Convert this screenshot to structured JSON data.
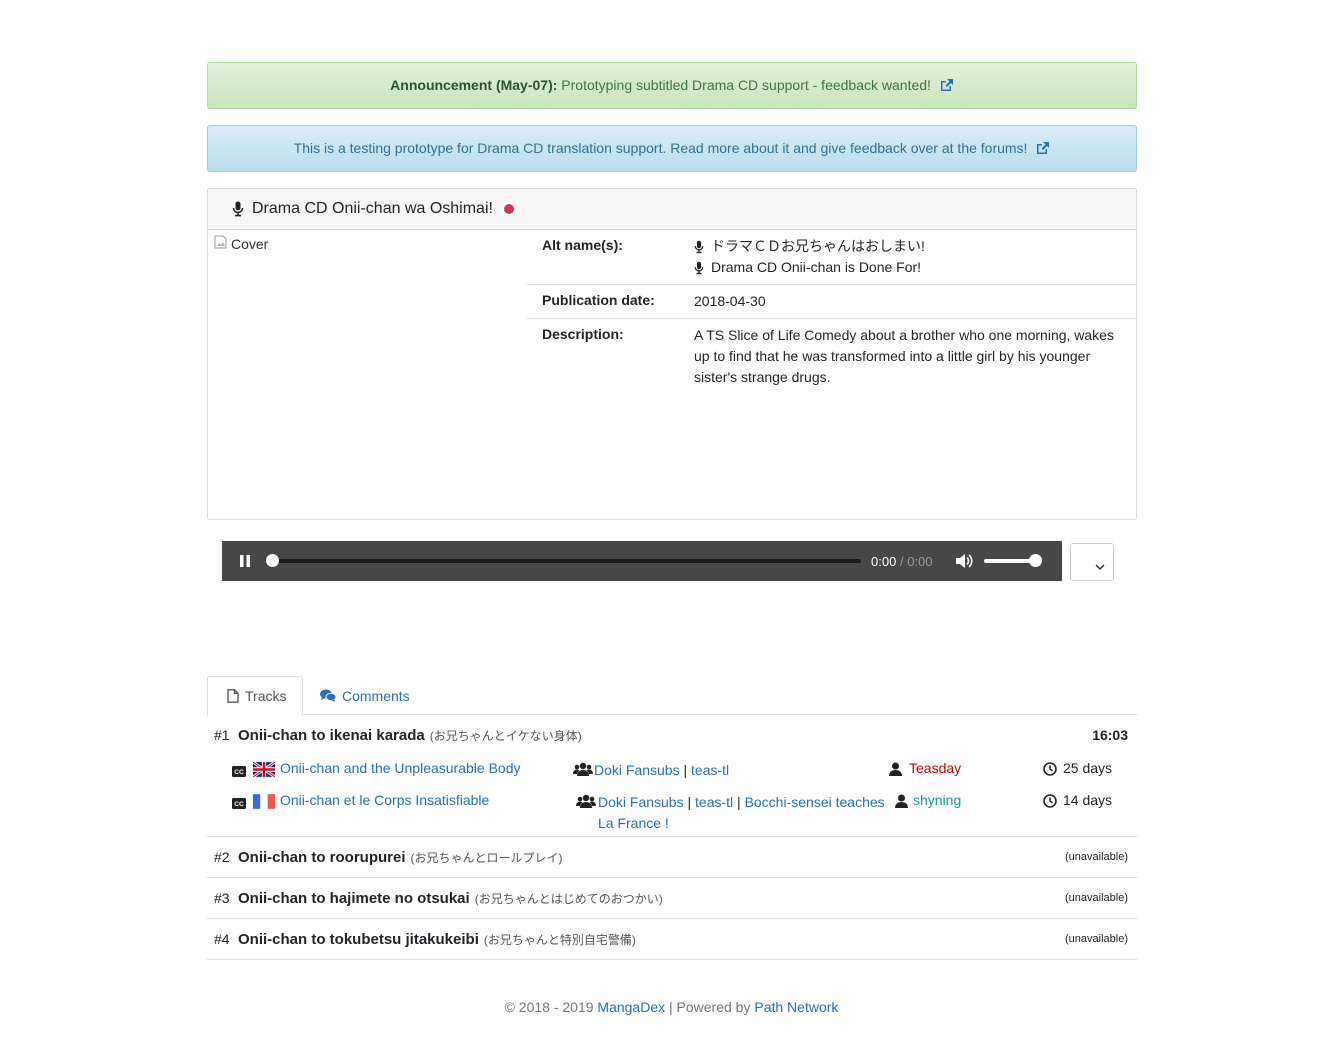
{
  "announcement": {
    "label": "Announcement (May-07):",
    "text": "Prototyping subtitled Drama CD support - feedback wanted!"
  },
  "info_banner": {
    "text": "This is a testing prototype for Drama CD translation support. Read more about it and give feedback over at the forums!"
  },
  "title": {
    "name": "Drama CD Onii-chan wa Oshimai!"
  },
  "cover": {
    "alt": "Cover"
  },
  "details": {
    "alt_label": "Alt name(s):",
    "alt_names": [
      "ドラマＣＤお兄ちゃんはおしまい!",
      "Drama CD Onii-chan is Done For!"
    ],
    "pub_label": "Publication date:",
    "pub_date": "2018-04-30",
    "desc_label": "Description:",
    "description": "A TS Slice of Life Comedy about a brother who one morning, wakes up to find that he was transformed into a little girl by his younger sister's strange drugs."
  },
  "player": {
    "current": "0:00",
    "separator": "/",
    "duration": "0:00",
    "progress": 0,
    "volume": 1.0
  },
  "tabs": {
    "tracks": "Tracks",
    "comments": "Comments"
  },
  "tracks": [
    {
      "num": "#1",
      "name": "Onii-chan to ikenai karada",
      "jp": "(お兄ちゃんとイケない身体)",
      "length": "16:03",
      "subs": [
        {
          "flag": "gb",
          "title": "Onii-chan and the Unpleasurable Body",
          "groups": [
            "Doki Fansubs",
            "teas-tl"
          ],
          "user": "Teasday",
          "age": "25 days"
        },
        {
          "flag": "fr",
          "title": "Onii-chan et le Corps Insatisfiable",
          "groups": [
            "Doki Fansubs",
            "teas-tl",
            "Bocchi-sensei teaches La France !"
          ],
          "user": "shyning",
          "age": "14 days"
        }
      ]
    },
    {
      "num": "#2",
      "name": "Onii-chan to roorupurei",
      "jp": "(お兄ちゃんとロールプレイ)",
      "status": "(unavailable)"
    },
    {
      "num": "#3",
      "name": "Onii-chan to hajimete no otsukai",
      "jp": "(お兄ちゃんとはじめてのおつかい)",
      "status": "(unavailable)"
    },
    {
      "num": "#4",
      "name": "Onii-chan to tokubetsu jitakukeibi",
      "jp": "(お兄ちゃんと特別自宅警備)",
      "status": "(unavailable)"
    }
  ],
  "footer": {
    "copyright": "© 2018 - 2019",
    "site": "MangaDex",
    "pipe": "|",
    "powered": "Powered by",
    "network": "Path Network"
  },
  "colors": {
    "link": "#2a6ebb",
    "uploader_red": "#cc0000",
    "uploader_teal": "#1e9a9a",
    "player_bg": "#474747"
  }
}
